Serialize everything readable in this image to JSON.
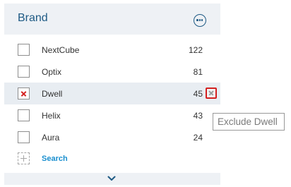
{
  "header": {
    "title": "Brand",
    "more_icon": "ellipsis-circle-icon"
  },
  "items": [
    {
      "label": "NextCube",
      "count": "122"
    },
    {
      "label": "Optix",
      "count": "81"
    },
    {
      "label": "Dwell",
      "count": "45"
    },
    {
      "label": "Helix",
      "count": "43"
    },
    {
      "label": "Aura",
      "count": "24"
    }
  ],
  "excluded_item": "Dwell",
  "exclude_icon": "exclude-x-icon",
  "search": {
    "label": "Search",
    "icon": "add-dashed-icon"
  },
  "expand_icon": "chevron-down-icon",
  "tooltip": {
    "text": "Exclude Dwell"
  },
  "colors": {
    "accent": "#1e5a84",
    "link": "#1a8fcf",
    "exclude": "#d32020",
    "header_bg": "#eef1f5",
    "row_highlight": "#e8edf2"
  }
}
